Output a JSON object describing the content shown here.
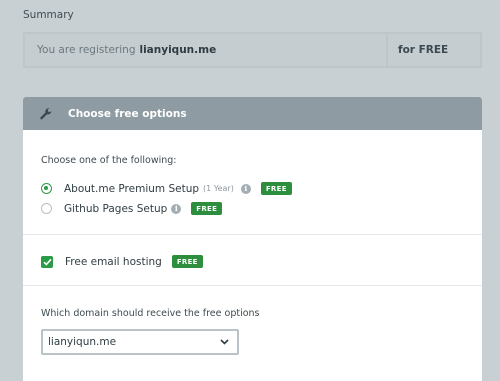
{
  "summary": {
    "label": "Summary",
    "registering_prefix": "You are registering",
    "domain": "lianyiqun.me",
    "price": "for FREE"
  },
  "panel": {
    "header": "Choose free options",
    "prompt": "Choose one of the following:",
    "options": [
      {
        "label": "About.me Premium Setup",
        "note": "(1 Year)",
        "badge": "FREE",
        "selected": true
      },
      {
        "label": "Github Pages Setup",
        "badge": "FREE",
        "selected": false
      }
    ],
    "email": {
      "label": "Free email hosting",
      "badge": "FREE",
      "checked": true
    },
    "domain_prompt": "Which domain should receive the free options",
    "domain_select": {
      "value": "lianyiqun.me"
    }
  },
  "colors": {
    "accent": "#2b9a47",
    "header": "#8e9ba2",
    "background": "#c9d0d4"
  }
}
